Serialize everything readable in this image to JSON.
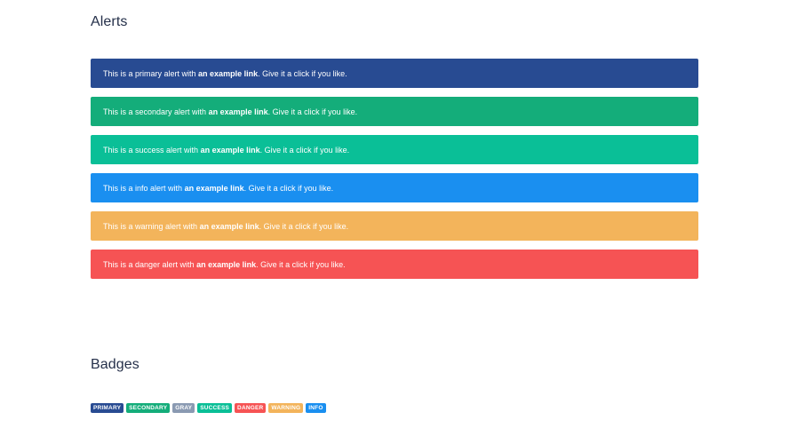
{
  "alerts_section": {
    "title": "Alerts",
    "items": [
      {
        "variant": "primary",
        "prefix": "This is a primary alert with ",
        "link": "an example link",
        "suffix": ". Give it a click if you like.",
        "color": "#284b92"
      },
      {
        "variant": "secondary",
        "prefix": "This is a secondary alert with ",
        "link": "an example link",
        "suffix": ". Give it a click if you like.",
        "color": "#14ad7a"
      },
      {
        "variant": "success",
        "prefix": "This is a success alert with ",
        "link": "an example link",
        "suffix": ". Give it a click if you like.",
        "color": "#0abf97"
      },
      {
        "variant": "info",
        "prefix": "This is a info alert with ",
        "link": "an example link",
        "suffix": ". Give it a click if you like.",
        "color": "#1a8ff0"
      },
      {
        "variant": "warning",
        "prefix": "This is a warning alert with ",
        "link": "an example link",
        "suffix": ". Give it a click if you like.",
        "color": "#f3b45b"
      },
      {
        "variant": "danger",
        "prefix": "This is a danger alert with ",
        "link": "an example link",
        "suffix": ". Give it a click if you like.",
        "color": "#f65354"
      }
    ]
  },
  "badges_section": {
    "title": "Badges",
    "items": [
      {
        "variant": "primary",
        "label": "PRIMARY",
        "color": "#284b92"
      },
      {
        "variant": "secondary",
        "label": "SECONDARY",
        "color": "#14ad7a"
      },
      {
        "variant": "gray",
        "label": "GRAY",
        "color": "#8a9ab2"
      },
      {
        "variant": "success",
        "label": "SUCCESS",
        "color": "#0abf97"
      },
      {
        "variant": "danger",
        "label": "DANGER",
        "color": "#f65354"
      },
      {
        "variant": "warning",
        "label": "WARNING",
        "color": "#f3b45b"
      },
      {
        "variant": "info",
        "label": "INFO",
        "color": "#1a8ff0"
      }
    ]
  }
}
